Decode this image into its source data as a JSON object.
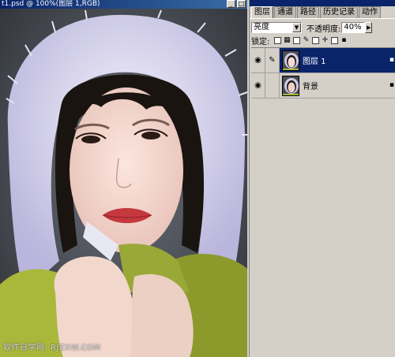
{
  "document": {
    "title": "t1.psd @ 100%(图层 1,RGB)",
    "window_buttons": {
      "minimize": "_",
      "maximize": "□"
    },
    "watermark": "软件自学网: RJZXW.COM"
  },
  "layers_palette": {
    "tabs": [
      {
        "label": "图层",
        "active": true
      },
      {
        "label": "通道",
        "active": false
      },
      {
        "label": "路径",
        "active": false
      },
      {
        "label": "历史记录",
        "active": false
      },
      {
        "label": "动作",
        "active": false
      }
    ],
    "blend_mode": "亮度",
    "opacity_label": "不透明度:",
    "opacity_value": "40%",
    "lock_label": "锁定:",
    "layers": [
      {
        "name": "图层 1",
        "visible": true,
        "selected": true,
        "brush_icon": "paintbrush-icon"
      },
      {
        "name": "背景",
        "visible": true,
        "selected": false,
        "brush_icon": ""
      }
    ]
  },
  "colors": {
    "selection": "#0a246a",
    "chrome": "#d4d0c8"
  }
}
